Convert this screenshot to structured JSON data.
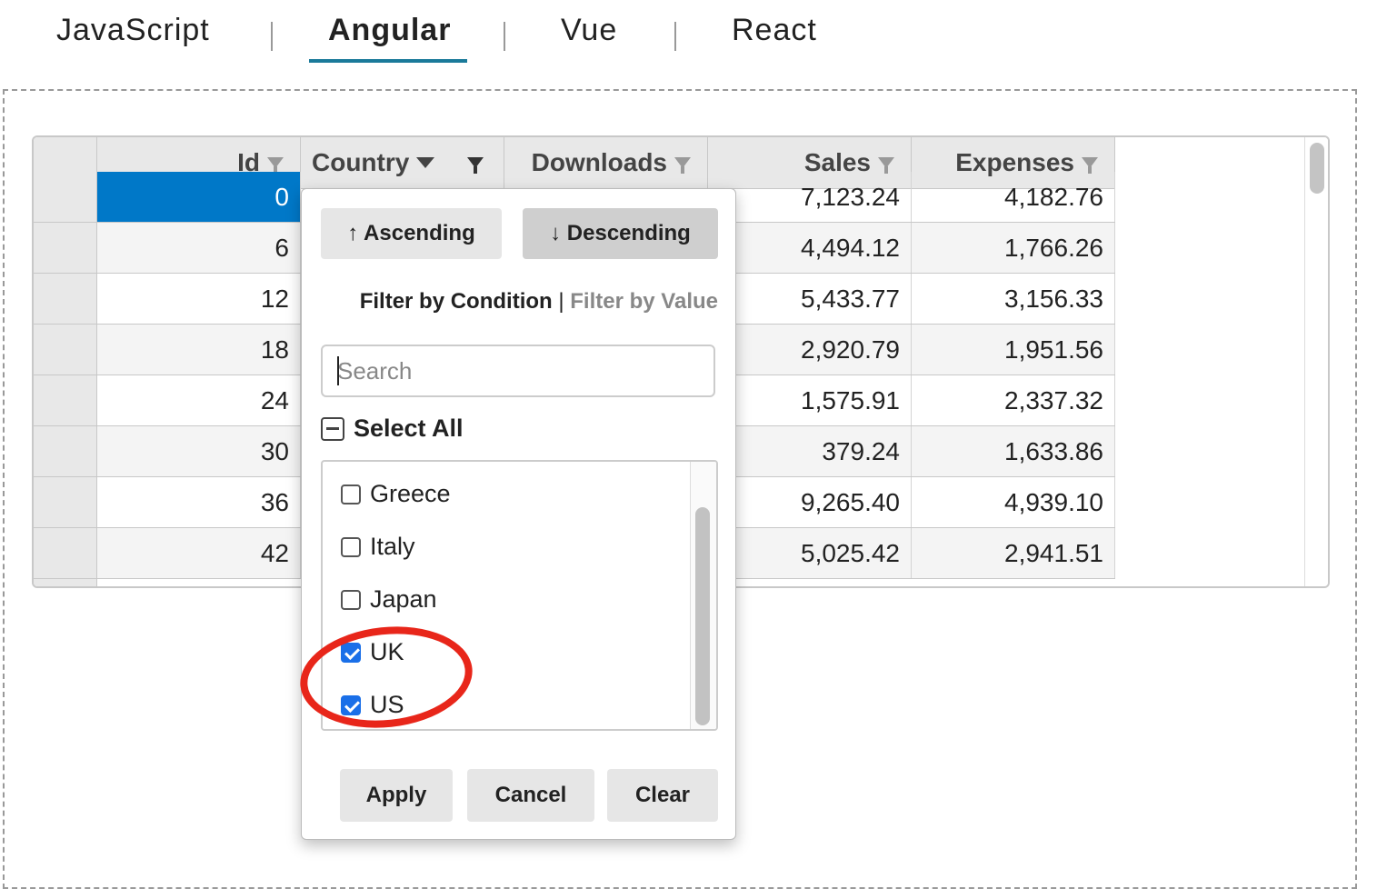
{
  "tabs": [
    {
      "label": "JavaScript"
    },
    {
      "label": "Angular"
    },
    {
      "label": "Vue"
    },
    {
      "label": "React"
    }
  ],
  "grid": {
    "columns": [
      {
        "label": "Id"
      },
      {
        "label": "Country"
      },
      {
        "label": "Downloads"
      },
      {
        "label": "Sales"
      },
      {
        "label": "Expenses"
      }
    ],
    "rows": [
      {
        "id": "0",
        "sales": "7,123.24",
        "expenses": "4,182.76"
      },
      {
        "id": "6",
        "sales": "4,494.12",
        "expenses": "1,766.26"
      },
      {
        "id": "12",
        "sales": "5,433.77",
        "expenses": "3,156.33"
      },
      {
        "id": "18",
        "sales": "2,920.79",
        "expenses": "1,951.56"
      },
      {
        "id": "24",
        "sales": "1,575.91",
        "expenses": "2,337.32"
      },
      {
        "id": "30",
        "sales": "379.24",
        "expenses": "1,633.86"
      },
      {
        "id": "36",
        "sales": "9,265.40",
        "expenses": "4,939.10"
      },
      {
        "id": "42",
        "sales": "5,025.42",
        "expenses": "2,941.51"
      }
    ]
  },
  "filter": {
    "ascending": "↑ Ascending",
    "descending": "↓ Descending",
    "by_condition": "Filter by Condition",
    "separator": "|",
    "by_value": "Filter by Value",
    "search_placeholder": "Search",
    "select_all": "Select All",
    "items": [
      {
        "label": "Greece",
        "checked": false
      },
      {
        "label": "Italy",
        "checked": false
      },
      {
        "label": "Japan",
        "checked": false
      },
      {
        "label": "UK",
        "checked": true
      },
      {
        "label": "US",
        "checked": true
      }
    ],
    "apply": "Apply",
    "cancel": "Cancel",
    "clear": "Clear"
  },
  "colors": {
    "accent": "#1a7a9a",
    "selection": "#0078c8",
    "checkbox": "#1a6fe8",
    "highlight": "#e8261a"
  }
}
